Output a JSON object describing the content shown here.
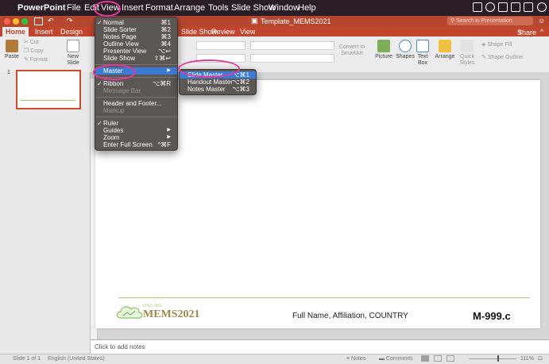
{
  "menubar": {
    "apple": "",
    "app": "PowerPoint",
    "items": [
      "File",
      "Edit",
      "View",
      "Insert",
      "Format",
      "Arrange",
      "Tools",
      "Slide Show",
      "Window",
      "Help"
    ]
  },
  "titlebar": {
    "doc_title": "Template_MEMS2021",
    "search_placeholder": "Search in Presentation"
  },
  "ribbon_tabs": [
    "Home",
    "Insert",
    "Design",
    "Slide Show",
    "Review",
    "View"
  ],
  "share_label": "Share",
  "ribbon": {
    "cut": "Cut",
    "copy": "Copy",
    "format": "Format",
    "paste": "Paste",
    "new_slide": "New Slide",
    "convert": "Convert to SmartArt",
    "picture": "Picture",
    "shapes": "Shapes",
    "text_box": "Text Box",
    "arrange": "Arrange",
    "quick_styles": "Quick Styles",
    "shape_fill": "Shape Fill",
    "shape_outline": "Shape Outline"
  },
  "thumbnail_number": "1",
  "view_menu": [
    {
      "label": "Normal",
      "shortcut": "⌘1",
      "checked": true
    },
    {
      "label": "Slide Sorter",
      "shortcut": "⌘2"
    },
    {
      "label": "Notes Page",
      "shortcut": "⌘3"
    },
    {
      "label": "Outline View",
      "shortcut": "⌘4"
    },
    {
      "label": "Presenter View",
      "shortcut": "⌥↩"
    },
    {
      "label": "Slide Show",
      "shortcut": "⇧⌘↩"
    },
    {
      "label": "Master",
      "submenu": true,
      "highlighted": true
    },
    {
      "label": "Ribbon",
      "shortcut": "⌥⌘R",
      "checked": true
    },
    {
      "label": "Message Bar",
      "disabled": true
    },
    {
      "label": "Header and Footer..."
    },
    {
      "label": "Markup",
      "disabled": true
    },
    {
      "label": "Ruler",
      "checked": true
    },
    {
      "label": "Guides",
      "submenu": true
    },
    {
      "label": "Zoom",
      "submenu": true
    },
    {
      "label": "Enter Full Screen",
      "shortcut": "^⌘F"
    }
  ],
  "master_submenu": [
    {
      "label": "Slide Master",
      "shortcut": "⌥⌘1",
      "highlighted": true
    },
    {
      "label": "Handout Master",
      "shortcut": "⌥⌘2"
    },
    {
      "label": "Notes Master",
      "shortcut": "⌥⌘3"
    }
  ],
  "slide": {
    "logo_top": "ONLINE",
    "logo_text": "MEMS2021",
    "footer_text": "Full Name, Affiliation, COUNTRY",
    "code": "M-999.c"
  },
  "notes_placeholder": "Click to add notes",
  "status": {
    "slide": "Slide 1 of 1",
    "language": "English (United States)",
    "notes": "Notes",
    "comments": "Comments",
    "zoom": "111%"
  },
  "colors": {
    "accent": "#c2452d",
    "menu_highlight": "#3b7bd8",
    "annotation": "#e23a9b"
  }
}
